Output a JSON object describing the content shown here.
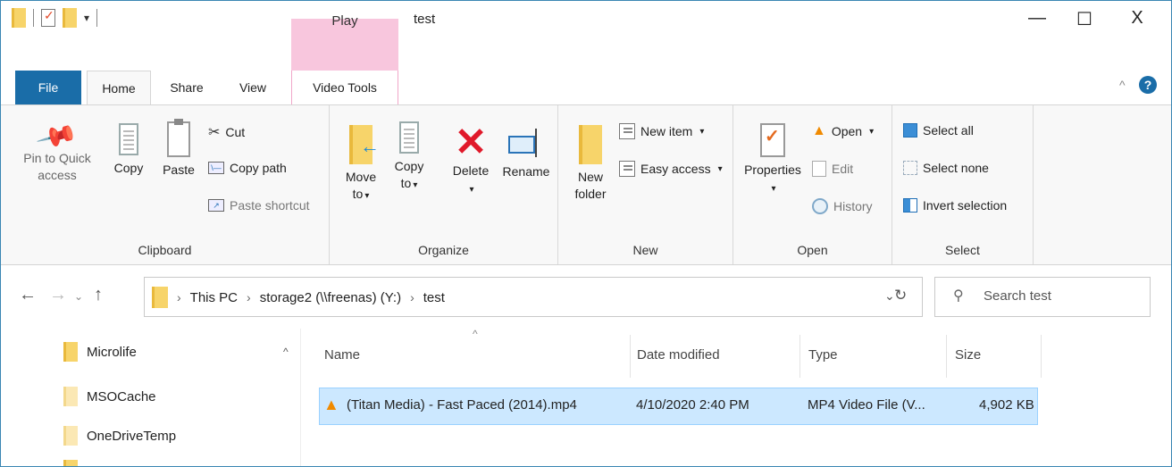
{
  "window": {
    "title": "test",
    "context_tab_group": "Play",
    "controls": {
      "minimize": "—",
      "maximize": "☐",
      "close": "X"
    }
  },
  "tabs": [
    "File",
    "Home",
    "Share",
    "View",
    "Video Tools"
  ],
  "ribbon": {
    "clipboard": {
      "label": "Clipboard",
      "pin": "Pin to Quick access",
      "pin_line1": "Pin to Quick",
      "pin_line2": "access",
      "copy": "Copy",
      "paste": "Paste",
      "cut": "Cut",
      "copy_path": "Copy path",
      "paste_shortcut": "Paste shortcut"
    },
    "organize": {
      "label": "Organize",
      "move_to_line1": "Move",
      "move_to_line2": "to",
      "copy_to_line1": "Copy",
      "copy_to_line2": "to",
      "delete": "Delete",
      "rename": "Rename"
    },
    "new": {
      "label": "New",
      "new_folder_line1": "New",
      "new_folder_line2": "folder",
      "new_item": "New item",
      "easy_access": "Easy access"
    },
    "open": {
      "label": "Open",
      "properties": "Properties",
      "open": "Open",
      "edit": "Edit",
      "history": "History"
    },
    "select": {
      "label": "Select",
      "select_all": "Select all",
      "select_none": "Select none",
      "invert_selection": "Invert selection"
    }
  },
  "address": {
    "crumbs": [
      "This PC",
      "storage2 (\\\\freenas) (Y:)",
      "test"
    ],
    "search_placeholder": "Search test"
  },
  "nav_pane": {
    "items": [
      "Microlife",
      "MSOCache",
      "OneDriveTemp"
    ]
  },
  "file_list": {
    "columns": [
      "Name",
      "Date modified",
      "Type",
      "Size"
    ],
    "rows": [
      {
        "name": "(Titan Media) - Fast Paced (2014).mp4",
        "date_modified": "4/10/2020 2:40 PM",
        "type": "MP4 Video File (V...",
        "size": "4,902 KB",
        "icon": "vlc-cone-icon",
        "selected": true
      }
    ]
  },
  "colors": {
    "file_tab": "#1a6da8",
    "context_tab": "#f8c6dd",
    "selection": "#cce8ff",
    "folder": "#f7d46a"
  }
}
